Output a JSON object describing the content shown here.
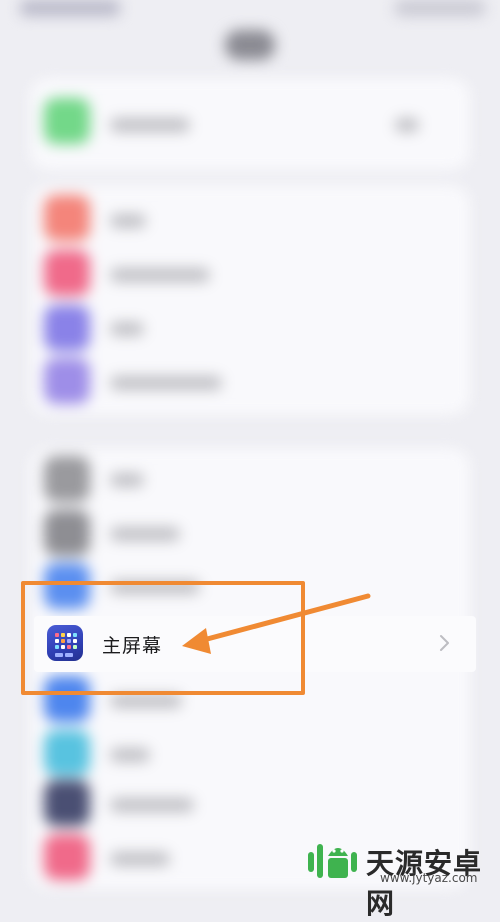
{
  "settings_row": {
    "label": "主屏幕",
    "icon": "home-screen-grid-icon",
    "chevron": "chevron-right-icon"
  },
  "annotation": {
    "highlight_color": "#f08a33",
    "arrow": "pointer-arrow-icon"
  },
  "watermark": {
    "brand": "天源安卓网",
    "url": "www.jytyaz.com",
    "logo": "android-logo-icon"
  }
}
